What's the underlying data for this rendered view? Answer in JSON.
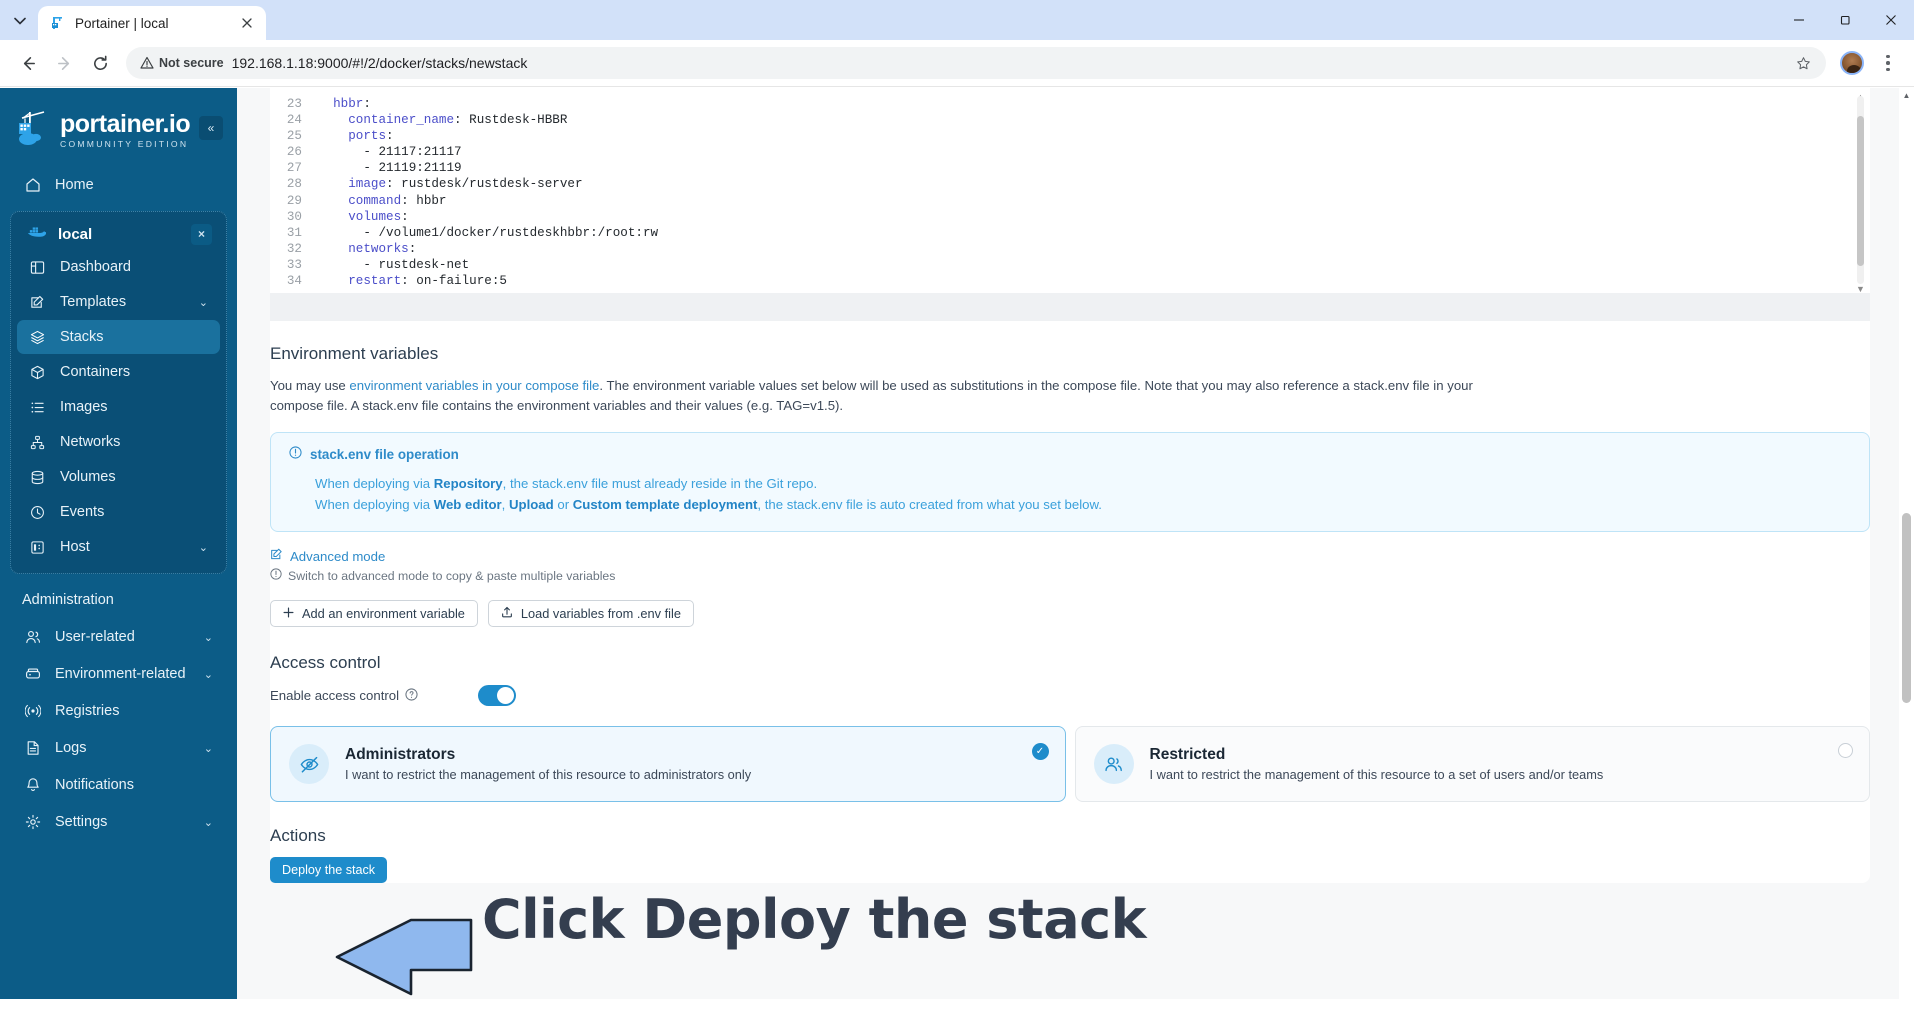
{
  "browser": {
    "tab": {
      "title": "Portainer | local",
      "favicon": "portainer-icon"
    },
    "url": "192.168.1.18:9000/#!/2/docker/stacks/newstack",
    "security_label": "Not secure",
    "window_controls": {
      "minimize": "–",
      "maximize": "❐",
      "close": "✕"
    }
  },
  "sidebar": {
    "brand_name": "portainer.io",
    "brand_sub": "COMMUNITY EDITION",
    "collapse_label": "«",
    "home": {
      "label": "Home",
      "icon": "home-icon"
    },
    "environment": {
      "label": "local",
      "icon": "docker-icon",
      "close": "×"
    },
    "env_items": [
      {
        "label": "Dashboard",
        "icon": "dashboard-icon",
        "chevron": "",
        "active": false
      },
      {
        "label": "Templates",
        "icon": "templates-icon",
        "chevron": "⌄",
        "active": false
      },
      {
        "label": "Stacks",
        "icon": "stacks-icon",
        "chevron": "",
        "active": true
      },
      {
        "label": "Containers",
        "icon": "containers-icon",
        "chevron": "",
        "active": false
      },
      {
        "label": "Images",
        "icon": "images-icon",
        "chevron": "",
        "active": false
      },
      {
        "label": "Networks",
        "icon": "networks-icon",
        "chevron": "",
        "active": false
      },
      {
        "label": "Volumes",
        "icon": "volumes-icon",
        "chevron": "",
        "active": false
      },
      {
        "label": "Events",
        "icon": "events-icon",
        "chevron": "",
        "active": false
      },
      {
        "label": "Host",
        "icon": "host-icon",
        "chevron": "⌄",
        "active": false
      }
    ],
    "admin_title": "Administration",
    "admin_items": [
      {
        "label": "User-related",
        "icon": "users-icon",
        "chevron": "⌄"
      },
      {
        "label": "Environment-related",
        "icon": "environment-icon",
        "chevron": "⌄"
      },
      {
        "label": "Registries",
        "icon": "registries-icon",
        "chevron": ""
      },
      {
        "label": "Logs",
        "icon": "logs-icon",
        "chevron": "⌄"
      },
      {
        "label": "Notifications",
        "icon": "bell-icon",
        "chevron": ""
      },
      {
        "label": "Settings",
        "icon": "gear-icon",
        "chevron": "⌄"
      }
    ]
  },
  "editor": {
    "lines": [
      {
        "n": "23",
        "indent": 2,
        "key": "hbbr",
        "rest": ":"
      },
      {
        "n": "24",
        "indent": 4,
        "key": "container_name",
        "rest": ": Rustdesk-HBBR"
      },
      {
        "n": "25",
        "indent": 4,
        "key": "ports",
        "rest": ":"
      },
      {
        "n": "26",
        "indent": 6,
        "key": "",
        "rest": "- 21117:21117"
      },
      {
        "n": "27",
        "indent": 6,
        "key": "",
        "rest": "- 21119:21119"
      },
      {
        "n": "28",
        "indent": 4,
        "key": "image",
        "rest": ": rustdesk/rustdesk-server"
      },
      {
        "n": "29",
        "indent": 4,
        "key": "command",
        "rest": ": hbbr"
      },
      {
        "n": "30",
        "indent": 4,
        "key": "volumes",
        "rest": ":"
      },
      {
        "n": "31",
        "indent": 6,
        "key": "",
        "rest": "- /volume1/docker/rustdeskhbbr:/root:rw"
      },
      {
        "n": "32",
        "indent": 4,
        "key": "networks",
        "rest": ":"
      },
      {
        "n": "33",
        "indent": 6,
        "key": "",
        "rest": "- rustdesk-net"
      },
      {
        "n": "34",
        "indent": 4,
        "key": "restart",
        "rest": ": on-failure:5"
      }
    ],
    "scroll_up": "▲",
    "scroll_down": "▼"
  },
  "env_section": {
    "title": "Environment variables",
    "help_pre": "You may use ",
    "help_link": "environment variables in your compose file",
    "help_post": ". The environment variable values set below will be used as substitutions in the compose file. Note that you may also reference a stack.env file in your compose file. A stack.env file contains the environment variables and their values (e.g. TAG=v1.5).",
    "infobox": {
      "icon": "info-icon",
      "title": "stack.env file operation",
      "line1_pre": "When deploying via ",
      "line1_bold": "Repository",
      "line1_post": ", the stack.env file must already reside in the Git repo.",
      "line2_pre": "When deploying via ",
      "line2_bold1": "Web editor",
      "line2_mid1": ", ",
      "line2_bold2": "Upload",
      "line2_mid2": " or ",
      "line2_bold3": "Custom template deployment",
      "line2_post": ", the stack.env file is auto created from what you set below."
    },
    "advanced_mode": "Advanced mode",
    "advanced_hint": "Switch to advanced mode to copy & paste multiple variables",
    "add_variable_btn": "Add an environment variable",
    "load_env_btn": "Load variables from .env file"
  },
  "access_control": {
    "title": "Access control",
    "toggle_label": "Enable access control",
    "toggle_on": true,
    "help_icon": "question-icon",
    "options": [
      {
        "name": "Administrators",
        "description": "I want to restrict the management of this resource to administrators only",
        "icon": "eye-off-icon",
        "selected": true,
        "check": "✓"
      },
      {
        "name": "Restricted",
        "description": "I want to restrict the management of this resource to a set of users and/or teams",
        "icon": "users-group-icon",
        "selected": false,
        "check": ""
      }
    ]
  },
  "actions": {
    "title": "Actions",
    "deploy_label": "Deploy the stack"
  },
  "annotation": {
    "text": "Click Deploy the stack",
    "arrow": "left-arrow-annotation",
    "arrow_fill": "#8fb8ee",
    "text_color": "#343e4f"
  },
  "colors": {
    "sidebar_bg": "#0c5c87",
    "accent": "#1e8ccb",
    "active_nav": "#1a719e"
  }
}
